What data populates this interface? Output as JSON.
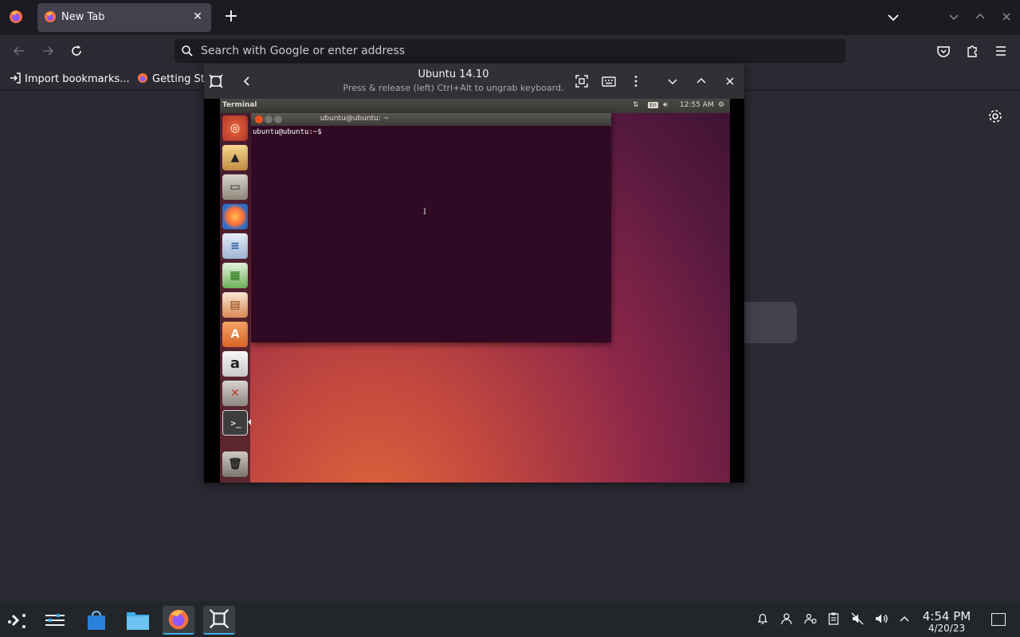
{
  "browser": {
    "tab": {
      "title": "New Tab"
    },
    "urlbar": {
      "placeholder": "Search with Google or enter address"
    },
    "bookmarks": [
      {
        "label": "Import bookmarks..."
      },
      {
        "label": "Getting Started"
      }
    ]
  },
  "vm": {
    "title": "Ubuntu 14.10",
    "subtitle": "Press & release (left) Ctrl+Alt to ungrab keyboard.",
    "guest": {
      "topbar": {
        "app_name": "Terminal",
        "keyboard_layout": "En",
        "time": "12:55 AM"
      },
      "launcher": [
        {
          "name": "Dash"
        },
        {
          "name": "Shotwell"
        },
        {
          "name": "Files"
        },
        {
          "name": "Firefox"
        },
        {
          "name": "LibreOffice Writer"
        },
        {
          "name": "LibreOffice Calc"
        },
        {
          "name": "LibreOffice Impress"
        },
        {
          "name": "Ubuntu Software Center"
        },
        {
          "name": "Amazon"
        },
        {
          "name": "System Settings"
        },
        {
          "name": "Terminal"
        },
        {
          "name": "Trash"
        }
      ],
      "terminal": {
        "title": "ubuntu@ubuntu: ~",
        "prompt": "ubuntu@ubuntu:~$"
      }
    }
  },
  "panel": {
    "clock_time": "4:54 PM",
    "clock_date": "4/20/23"
  },
  "colors": {
    "accent": "#3daee9",
    "terminal_bg": "#300a24",
    "firefox_toolbar": "#2b2a33"
  }
}
